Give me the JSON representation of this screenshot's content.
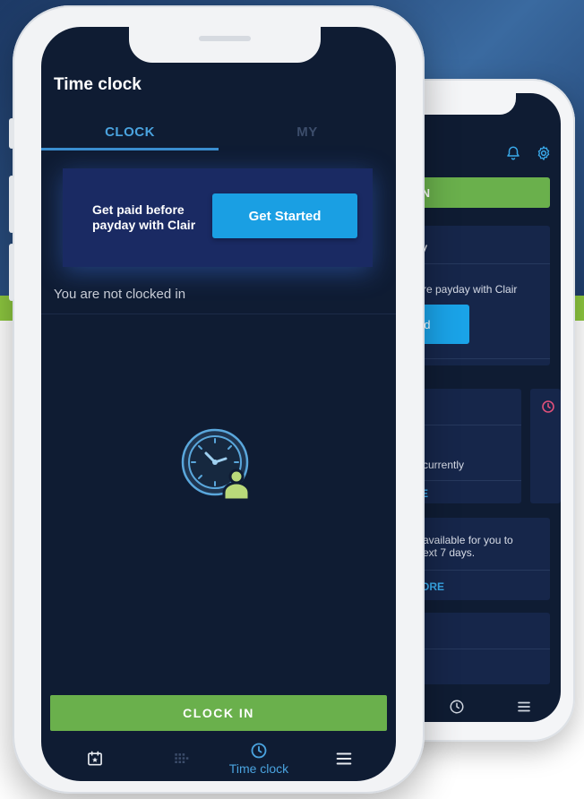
{
  "front": {
    "title": "Time clock",
    "tabs": [
      {
        "label": "CLOCK",
        "active": true
      },
      {
        "label": "MY",
        "active": false
      }
    ],
    "promo": {
      "text": "Get paid before payday with Clair",
      "button": "Get Started"
    },
    "status": "You are not clocked in",
    "hero_icon": "clock-user-icon",
    "clock_in_button": "CLOCK IN",
    "nav": [
      {
        "icon": "calendar-star-icon"
      },
      {
        "icon": "schedule-grid-icon"
      },
      {
        "icon": "clock-icon",
        "label": "Time clock",
        "active": true
      },
      {
        "icon": "menu-icon"
      }
    ]
  },
  "back": {
    "header_icons": [
      "bell-icon",
      "gear-icon"
    ],
    "clock_in_partial": "IN",
    "card_title_partial": "y",
    "promo_partial": "re payday with Clair",
    "button_partial": "ed",
    "info_partial": "currently",
    "link1_partial": "E",
    "shifts_line1": "available for you to",
    "shifts_line2": "ext 7 days.",
    "link2_partial": "ORE",
    "nav_icons": [
      "clock-icon",
      "menu-icon"
    ]
  },
  "colors": {
    "screen_bg": "#0f1c33",
    "accent_blue": "#1a9fe3",
    "tab_active": "#4aa3df",
    "clock_in_green": "#6ab04c",
    "promo_bg": "#1a2a63",
    "brand_green": "#8cc63f"
  }
}
